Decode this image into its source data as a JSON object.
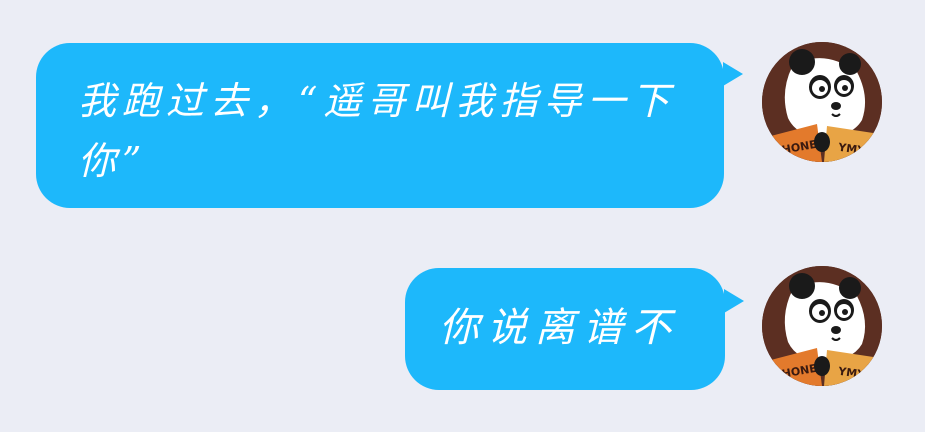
{
  "conversation": {
    "messages": [
      {
        "sender": "panda-avatar",
        "text": "我跑过去，“遥哥叫我指导一下你”"
      },
      {
        "sender": "panda-avatar",
        "text": "你说离谱不"
      }
    ],
    "avatar_shirt_text": "HONEY YMY"
  },
  "colors": {
    "background": "#ebedf5",
    "bubble": "#1db8fb",
    "bubble_text": "#ffffff"
  }
}
